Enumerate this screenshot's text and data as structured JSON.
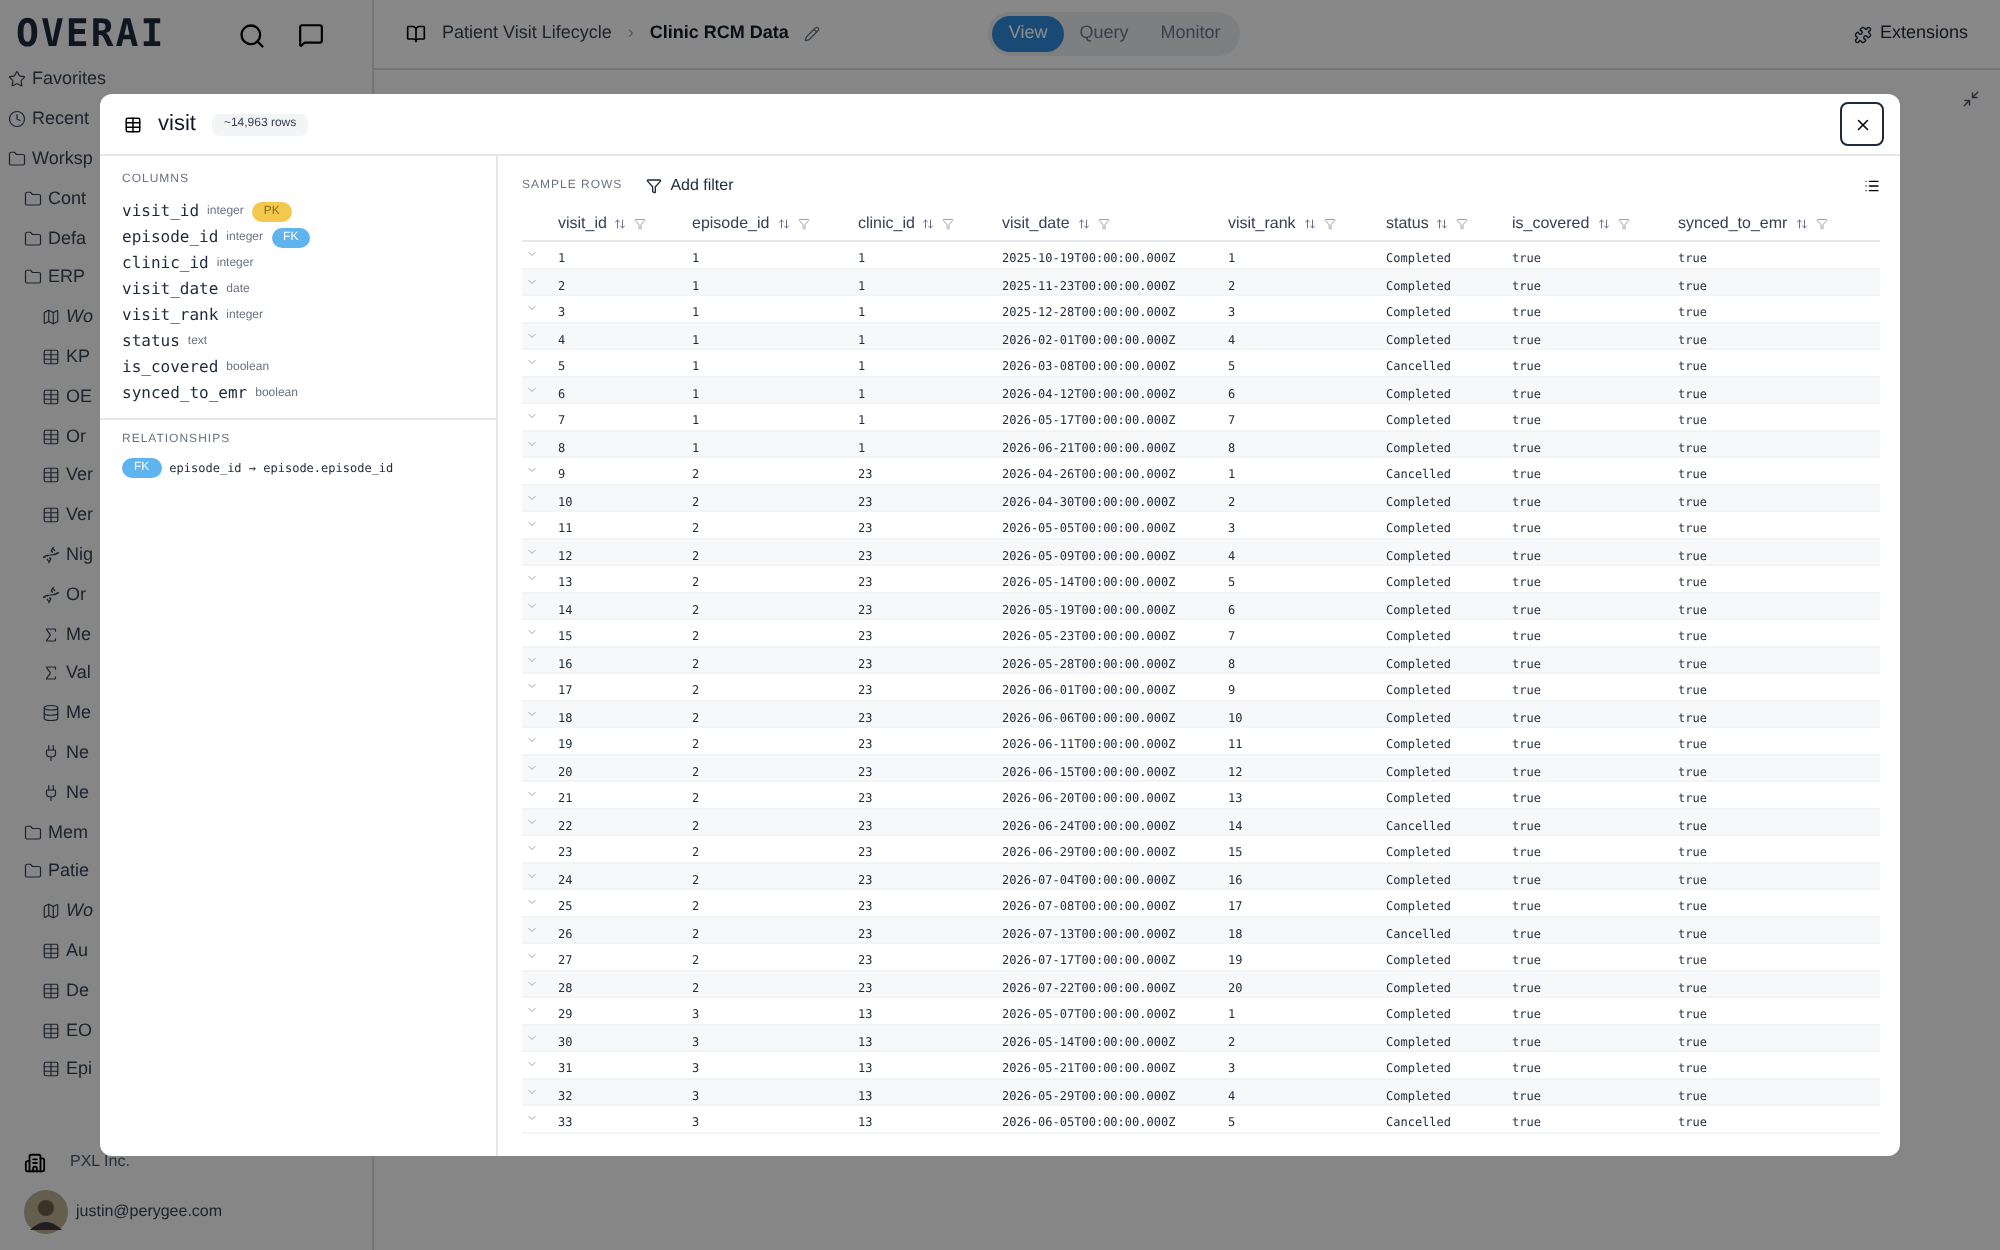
{
  "app": {
    "logo": "OVERAI",
    "breadcrumb": "Patient Visit Lifecycle",
    "separator": "›",
    "title": "Clinic RCM Data",
    "tabs": [
      {
        "label": "View",
        "selected": true
      },
      {
        "label": "Query",
        "selected": false
      },
      {
        "label": "Monitor",
        "selected": false
      }
    ],
    "extensions": "Extensions"
  },
  "sidebar": {
    "items": [
      {
        "label": "Favorites",
        "kind": "star"
      },
      {
        "label": "Recent",
        "kind": "clock"
      },
      {
        "label": "Worksp",
        "kind": "folder",
        "children": [
          {
            "label": "Cont",
            "kind": "folder"
          },
          {
            "label": "Defa",
            "kind": "folder"
          },
          {
            "label": "ERP",
            "kind": "folder",
            "children": [
              {
                "label": "Wo",
                "kind": "map"
              },
              {
                "label": "KP",
                "kind": "table"
              },
              {
                "label": "OE",
                "kind": "table"
              },
              {
                "label": "Or",
                "kind": "table"
              },
              {
                "label": "Ver",
                "kind": "table"
              },
              {
                "label": "Ver",
                "kind": "table"
              },
              {
                "label": "Nig",
                "kind": "agent"
              },
              {
                "label": "Or",
                "kind": "agent"
              },
              {
                "label": "Me",
                "kind": "function"
              },
              {
                "label": "Val",
                "kind": "function"
              },
              {
                "label": "Me",
                "kind": "database"
              },
              {
                "label": "Ne",
                "kind": "plug"
              },
              {
                "label": "Ne",
                "kind": "plug"
              }
            ]
          },
          {
            "label": "Mem",
            "kind": "folder"
          },
          {
            "label": "Patie",
            "kind": "folder",
            "children": [
              {
                "label": "Wo",
                "kind": "map"
              },
              {
                "label": "Au",
                "kind": "table"
              },
              {
                "label": "De",
                "kind": "table"
              },
              {
                "label": "EO",
                "kind": "table"
              },
              {
                "label": "Epi",
                "kind": "table"
              }
            ]
          }
        ]
      }
    ],
    "org": "PXL Inc.",
    "user": "justin@perygee.com"
  },
  "modal": {
    "title": "visit",
    "row_count": "~14,963 rows",
    "columns_heading": "COLUMNS",
    "columns": [
      {
        "name": "visit_id",
        "type": "integer",
        "key": "PK"
      },
      {
        "name": "episode_id",
        "type": "integer",
        "key": "FK"
      },
      {
        "name": "clinic_id",
        "type": "integer"
      },
      {
        "name": "visit_date",
        "type": "date"
      },
      {
        "name": "visit_rank",
        "type": "integer"
      },
      {
        "name": "status",
        "type": "text"
      },
      {
        "name": "is_covered",
        "type": "boolean"
      },
      {
        "name": "synced_to_emr",
        "type": "boolean"
      }
    ],
    "relationships_heading": "RELATIONSHIPS",
    "relationships": [
      {
        "key": "FK",
        "text": "episode_id → episode.episode_id"
      }
    ],
    "sample_heading": "SAMPLE ROWS",
    "add_filter": "Add filter",
    "table": {
      "columns": [
        "visit_id",
        "episode_id",
        "clinic_id",
        "visit_date",
        "visit_rank",
        "status",
        "is_covered",
        "synced_to_emr"
      ],
      "rows": [
        [
          "1",
          "1",
          "1",
          "2025-10-19T00:00:00.000Z",
          "1",
          "Completed",
          "true",
          "true"
        ],
        [
          "2",
          "1",
          "1",
          "2025-11-23T00:00:00.000Z",
          "2",
          "Completed",
          "true",
          "true"
        ],
        [
          "3",
          "1",
          "1",
          "2025-12-28T00:00:00.000Z",
          "3",
          "Completed",
          "true",
          "true"
        ],
        [
          "4",
          "1",
          "1",
          "2026-02-01T00:00:00.000Z",
          "4",
          "Completed",
          "true",
          "true"
        ],
        [
          "5",
          "1",
          "1",
          "2026-03-08T00:00:00.000Z",
          "5",
          "Cancelled",
          "true",
          "true"
        ],
        [
          "6",
          "1",
          "1",
          "2026-04-12T00:00:00.000Z",
          "6",
          "Completed",
          "true",
          "true"
        ],
        [
          "7",
          "1",
          "1",
          "2026-05-17T00:00:00.000Z",
          "7",
          "Completed",
          "true",
          "true"
        ],
        [
          "8",
          "1",
          "1",
          "2026-06-21T00:00:00.000Z",
          "8",
          "Completed",
          "true",
          "true"
        ],
        [
          "9",
          "2",
          "23",
          "2026-04-26T00:00:00.000Z",
          "1",
          "Cancelled",
          "true",
          "true"
        ],
        [
          "10",
          "2",
          "23",
          "2026-04-30T00:00:00.000Z",
          "2",
          "Completed",
          "true",
          "true"
        ],
        [
          "11",
          "2",
          "23",
          "2026-05-05T00:00:00.000Z",
          "3",
          "Completed",
          "true",
          "true"
        ],
        [
          "12",
          "2",
          "23",
          "2026-05-09T00:00:00.000Z",
          "4",
          "Completed",
          "true",
          "true"
        ],
        [
          "13",
          "2",
          "23",
          "2026-05-14T00:00:00.000Z",
          "5",
          "Completed",
          "true",
          "true"
        ],
        [
          "14",
          "2",
          "23",
          "2026-05-19T00:00:00.000Z",
          "6",
          "Completed",
          "true",
          "true"
        ],
        [
          "15",
          "2",
          "23",
          "2026-05-23T00:00:00.000Z",
          "7",
          "Completed",
          "true",
          "true"
        ],
        [
          "16",
          "2",
          "23",
          "2026-05-28T00:00:00.000Z",
          "8",
          "Completed",
          "true",
          "true"
        ],
        [
          "17",
          "2",
          "23",
          "2026-06-01T00:00:00.000Z",
          "9",
          "Completed",
          "true",
          "true"
        ],
        [
          "18",
          "2",
          "23",
          "2026-06-06T00:00:00.000Z",
          "10",
          "Completed",
          "true",
          "true"
        ],
        [
          "19",
          "2",
          "23",
          "2026-06-11T00:00:00.000Z",
          "11",
          "Completed",
          "true",
          "true"
        ],
        [
          "20",
          "2",
          "23",
          "2026-06-15T00:00:00.000Z",
          "12",
          "Completed",
          "true",
          "true"
        ],
        [
          "21",
          "2",
          "23",
          "2026-06-20T00:00:00.000Z",
          "13",
          "Completed",
          "true",
          "true"
        ],
        [
          "22",
          "2",
          "23",
          "2026-06-24T00:00:00.000Z",
          "14",
          "Cancelled",
          "true",
          "true"
        ],
        [
          "23",
          "2",
          "23",
          "2026-06-29T00:00:00.000Z",
          "15",
          "Completed",
          "true",
          "true"
        ],
        [
          "24",
          "2",
          "23",
          "2026-07-04T00:00:00.000Z",
          "16",
          "Completed",
          "true",
          "true"
        ],
        [
          "25",
          "2",
          "23",
          "2026-07-08T00:00:00.000Z",
          "17",
          "Completed",
          "true",
          "true"
        ],
        [
          "26",
          "2",
          "23",
          "2026-07-13T00:00:00.000Z",
          "18",
          "Cancelled",
          "true",
          "true"
        ],
        [
          "27",
          "2",
          "23",
          "2026-07-17T00:00:00.000Z",
          "19",
          "Completed",
          "true",
          "true"
        ],
        [
          "28",
          "2",
          "23",
          "2026-07-22T00:00:00.000Z",
          "20",
          "Completed",
          "true",
          "true"
        ],
        [
          "29",
          "3",
          "13",
          "2026-05-07T00:00:00.000Z",
          "1",
          "Completed",
          "true",
          "true"
        ],
        [
          "30",
          "3",
          "13",
          "2026-05-14T00:00:00.000Z",
          "2",
          "Completed",
          "true",
          "true"
        ],
        [
          "31",
          "3",
          "13",
          "2026-05-21T00:00:00.000Z",
          "3",
          "Completed",
          "true",
          "true"
        ],
        [
          "32",
          "3",
          "13",
          "2026-05-29T00:00:00.000Z",
          "4",
          "Completed",
          "true",
          "true"
        ],
        [
          "33",
          "3",
          "13",
          "2026-06-05T00:00:00.000Z",
          "5",
          "Cancelled",
          "true",
          "true"
        ]
      ]
    }
  }
}
